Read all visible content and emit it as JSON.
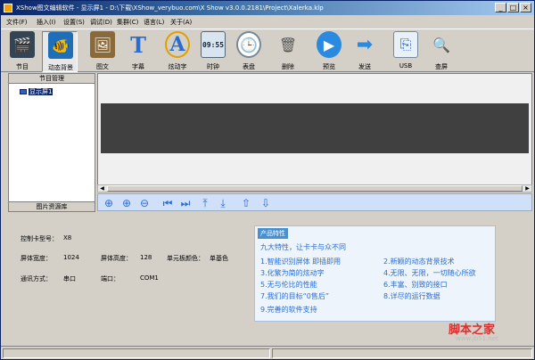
{
  "window": {
    "title": "XShow图文编辑软件 - 显示屏1 - D:\\下载\\XShow_verybuo.com\\X Show v3.0.0.2181\\Project\\Xalerka.klp"
  },
  "menu": [
    {
      "label": "文件(F)"
    },
    {
      "label": "插入(I)"
    },
    {
      "label": "设置(S)"
    },
    {
      "label": "调试(D)"
    },
    {
      "label": "集群(C)"
    },
    {
      "label": "语言(L)"
    },
    {
      "label": "关于(A)"
    }
  ],
  "toolbar": [
    {
      "label": "节目",
      "icon": "clapper-icon",
      "glyph": "🎬"
    },
    {
      "label": "动态背景",
      "icon": "fish-icon",
      "glyph": "🐠"
    },
    {
      "label": "图文",
      "icon": "picture-icon",
      "glyph": "🖼"
    },
    {
      "label": "字幕",
      "icon": "text-t-icon",
      "glyph": "T"
    },
    {
      "label": "炫动字",
      "icon": "animated-text-icon",
      "glyph": "A"
    },
    {
      "label": "时钟",
      "icon": "digital-clock-icon",
      "glyph": "09:55"
    },
    {
      "label": "表盘",
      "icon": "analog-clock-icon",
      "glyph": "🕒"
    },
    {
      "label": "删除",
      "icon": "trash-icon",
      "glyph": "🗑"
    },
    {
      "label": "预览",
      "icon": "play-icon",
      "glyph": "▶"
    },
    {
      "label": "发送",
      "icon": "send-arrow-icon",
      "glyph": "➡"
    },
    {
      "label": "USB",
      "icon": "usb-icon",
      "glyph": "⎘"
    },
    {
      "label": "查屏",
      "icon": "magnifier-icon",
      "glyph": "🔍"
    }
  ],
  "left_panel": {
    "header": "节目管理",
    "tree_item": "显示屏1",
    "footer": "图片资源库"
  },
  "nav_buttons": [
    {
      "icon": "zoom-fit-icon",
      "glyph": "⊕"
    },
    {
      "icon": "zoom-in-icon",
      "glyph": "⊕"
    },
    {
      "icon": "zoom-out-icon",
      "glyph": "⊖"
    },
    {
      "icon": "first-icon",
      "glyph": "⏮"
    },
    {
      "icon": "last-icon",
      "glyph": "⏭"
    },
    {
      "icon": "top-align-icon",
      "glyph": "⤒"
    },
    {
      "icon": "bottom-align-icon",
      "glyph": "⤓"
    },
    {
      "icon": "move-up-icon",
      "glyph": "⇧"
    },
    {
      "icon": "move-down-icon",
      "glyph": "⇩"
    }
  ],
  "props": {
    "controller_label": "控制卡型号：",
    "controller_value": "X8",
    "width_label": "屏体宽度：",
    "width_value": "1024",
    "height_label": "屏体高度：",
    "height_value": "128",
    "color_label": "单元板颜色：",
    "color_value": "单基色",
    "comm_label": "通讯方式：",
    "comm_value": "串口",
    "port_label": "端口：",
    "port_value": "COM1"
  },
  "features": {
    "tag": "产品特性",
    "lead": "九大特性，让卡卡与众不同",
    "items": [
      "1.智能识别屏体 即插即用",
      "2.新颖的动态背景技术",
      "3.化繁为简的炫动字",
      "4.无限、无限，一切随心所欲",
      "5.无与伦比的性能",
      "6.丰富、别致的接口",
      "7.我们的目标“0售后”",
      "8.详尽的运行数据",
      "9.完善的软件支持"
    ]
  },
  "watermark": {
    "text": "脚本之家",
    "url": "www.jb51.net"
  }
}
